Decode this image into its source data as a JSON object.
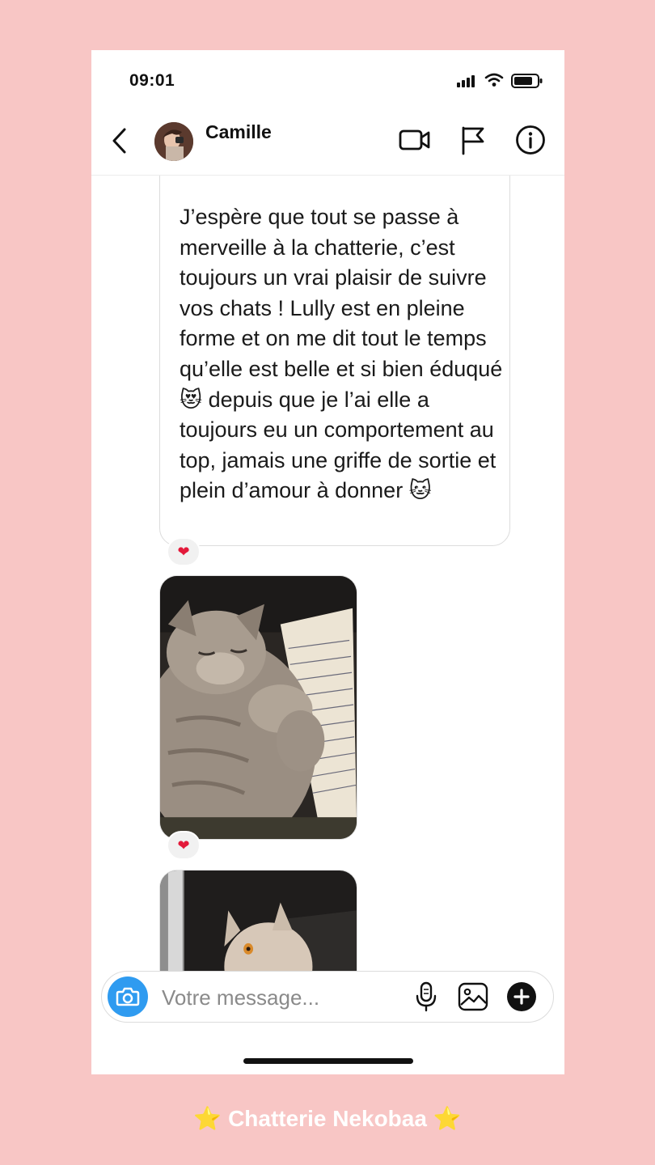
{
  "status_bar": {
    "time": "09:01"
  },
  "header": {
    "contact_name": "Camille",
    "icons": [
      "back-icon",
      "video-call-icon",
      "flag-icon",
      "info-icon"
    ]
  },
  "messages": [
    {
      "type": "text",
      "text": "J’espère que tout se passe à merveille à la chatterie, c’est toujours un vrai plaisir de suivre vos chats ! Lully est en pleine forme et on me dit tout le temps qu’elle est belle et si bien éduqué 😻 depuis que je l’ai elle a toujours eu un comportement au top, jamais une griffe de sortie et plein d’amour à donner 🐱",
      "reaction": "❤"
    },
    {
      "type": "photo",
      "description": "cat-sleeping-on-notes",
      "reaction": "❤"
    },
    {
      "type": "photo",
      "description": "cat-portrait"
    }
  ],
  "composer": {
    "placeholder": "Votre message...",
    "value": ""
  },
  "footer": {
    "star": "⭐",
    "caption": "Chatterie Nekobaa"
  },
  "colors": {
    "background": "#f8c6c5",
    "camera_button": "#2f9bf0",
    "reaction_heart": "#e3193a"
  }
}
